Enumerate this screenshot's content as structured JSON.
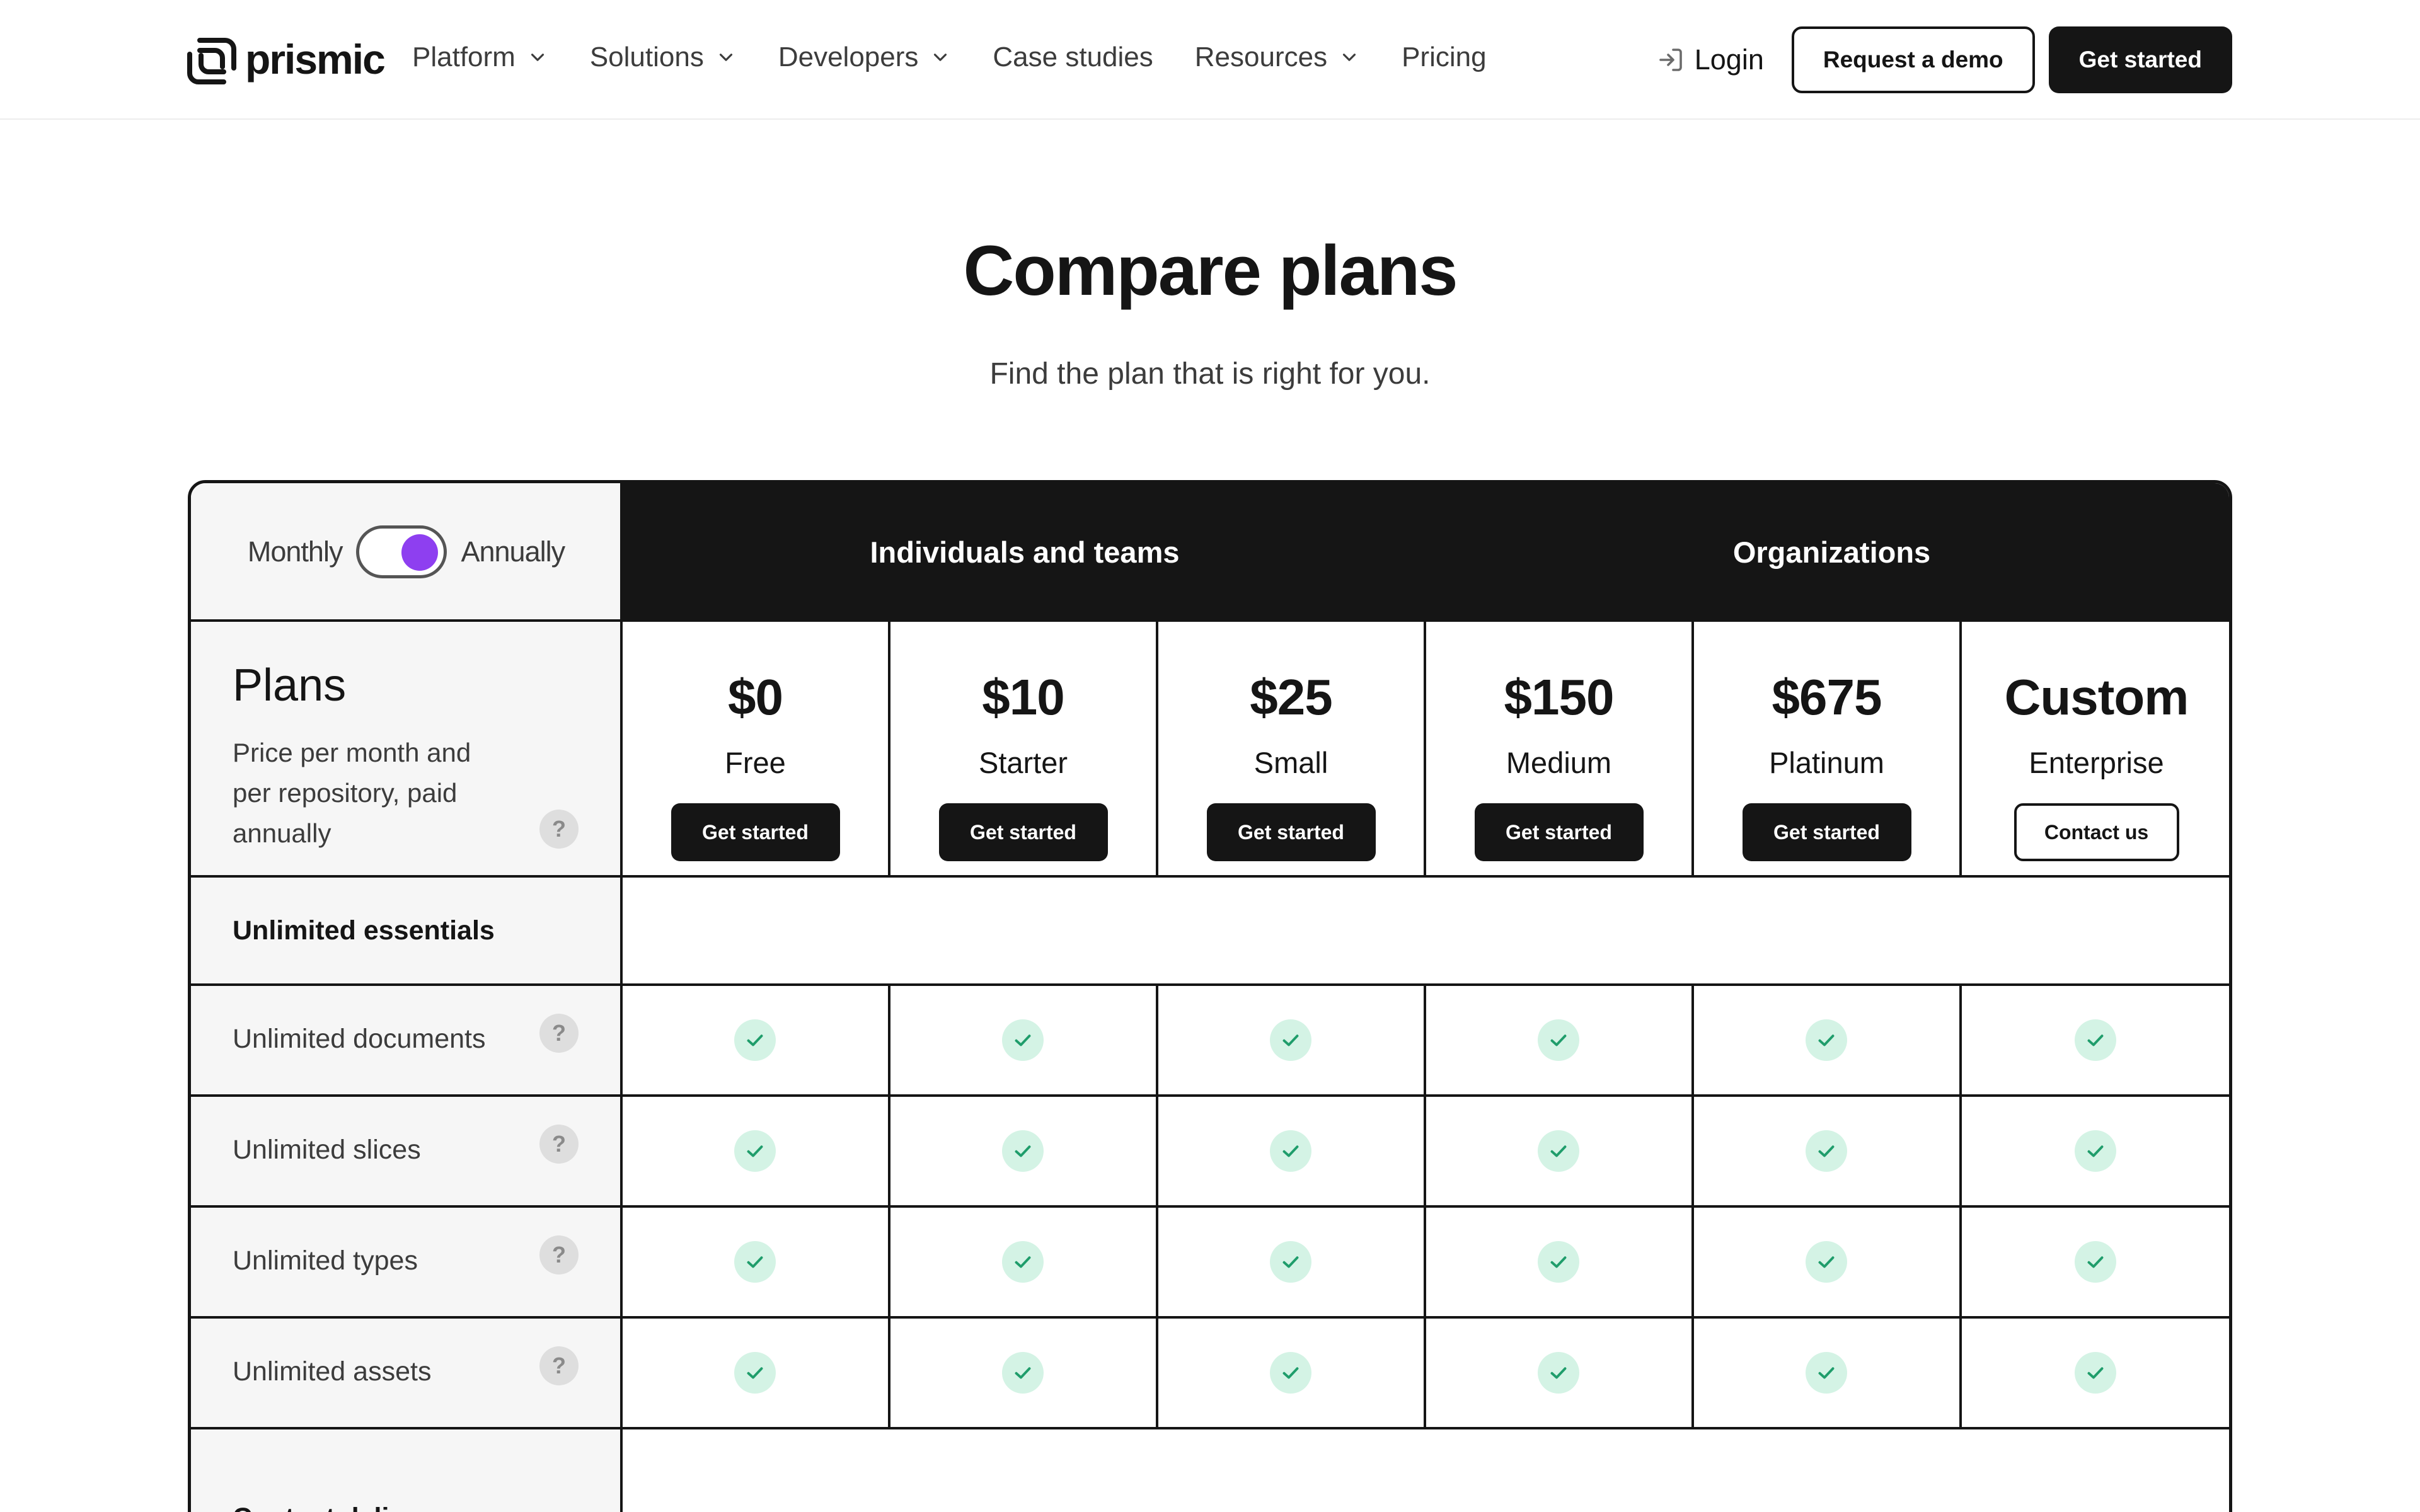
{
  "brand": {
    "name": "prismic"
  },
  "nav": {
    "items": [
      {
        "label": "Platform",
        "dropdown": true
      },
      {
        "label": "Solutions",
        "dropdown": true
      },
      {
        "label": "Developers",
        "dropdown": true
      },
      {
        "label": "Case studies",
        "dropdown": false
      },
      {
        "label": "Resources",
        "dropdown": true
      },
      {
        "label": "Pricing",
        "dropdown": false
      }
    ],
    "login": "Login",
    "request_demo": "Request a demo",
    "get_started": "Get started"
  },
  "hero": {
    "title": "Compare plans",
    "subtitle": "Find the plan that is right for you."
  },
  "billing_toggle": {
    "left": "Monthly",
    "right": "Annually",
    "selected": "Annually"
  },
  "groups": [
    "Individuals and teams",
    "Organizations"
  ],
  "plans_header": {
    "title": "Plans",
    "description": "Price per month and per repository, paid annually"
  },
  "plans": [
    {
      "price": "$0",
      "name": "Free",
      "cta": "Get started"
    },
    {
      "price": "$10",
      "name": "Starter",
      "cta": "Get started"
    },
    {
      "price": "$25",
      "name": "Small",
      "cta": "Get started"
    },
    {
      "price": "$150",
      "name": "Medium",
      "cta": "Get started"
    },
    {
      "price": "$675",
      "name": "Platinum",
      "cta": "Get started"
    },
    {
      "price": "Custom",
      "name": "Enterprise",
      "cta": "Contact us"
    }
  ],
  "sections": [
    {
      "title": "Unlimited essentials",
      "features": [
        {
          "label": "Unlimited documents",
          "values": [
            true,
            true,
            true,
            true,
            true,
            true
          ]
        },
        {
          "label": "Unlimited slices",
          "values": [
            true,
            true,
            true,
            true,
            true,
            true
          ]
        },
        {
          "label": "Unlimited types",
          "values": [
            true,
            true,
            true,
            true,
            true,
            true
          ]
        },
        {
          "label": "Unlimited assets",
          "values": [
            true,
            true,
            true,
            true,
            true,
            true
          ]
        }
      ]
    },
    {
      "title": "Content delivery",
      "features": []
    }
  ],
  "colors": {
    "ink": "#151515",
    "accent": "#8e3ff0",
    "check_bg": "#d4f3e5",
    "check_fg": "#1f9d6b",
    "label_bg": "#f6f6f6"
  }
}
